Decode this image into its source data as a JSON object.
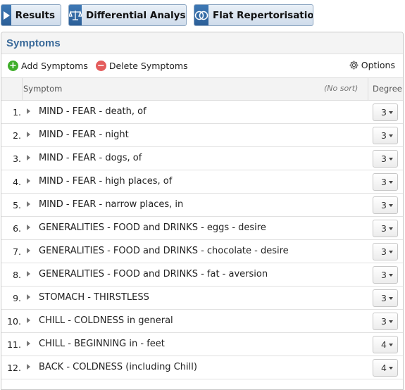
{
  "toolbar": {
    "results_label": "Results",
    "differential_label": "Differential Analysis",
    "flat_label": "Flat Repertorisation"
  },
  "panel": {
    "title": "Symptoms",
    "add_label": "Add Symptoms",
    "delete_label": "Delete Symptoms",
    "options_label": "Options"
  },
  "table": {
    "col_symptom": "Symptom",
    "sort_label": "(No sort)",
    "col_degree": "Degree",
    "rows": [
      {
        "num": "1.",
        "symptom": "MIND - FEAR - death, of",
        "degree": "3"
      },
      {
        "num": "2.",
        "symptom": "MIND - FEAR - night",
        "degree": "3"
      },
      {
        "num": "3.",
        "symptom": "MIND - FEAR - dogs, of",
        "degree": "3"
      },
      {
        "num": "4.",
        "symptom": "MIND - FEAR - high places, of",
        "degree": "3"
      },
      {
        "num": "5.",
        "symptom": "MIND - FEAR - narrow places, in",
        "degree": "3"
      },
      {
        "num": "6.",
        "symptom": "GENERALITIES - FOOD and DRINKS - eggs - desire",
        "degree": "3"
      },
      {
        "num": "7.",
        "symptom": "GENERALITIES - FOOD and DRINKS - chocolate - desire",
        "degree": "3"
      },
      {
        "num": "8.",
        "symptom": "GENERALITIES - FOOD and DRINKS - fat - aversion",
        "degree": "3"
      },
      {
        "num": "9.",
        "symptom": "STOMACH - THIRSTLESS",
        "degree": "3"
      },
      {
        "num": "10.",
        "symptom": "CHILL - COLDNESS in general",
        "degree": "3"
      },
      {
        "num": "11.",
        "symptom": "CHILL - BEGINNING in - feet",
        "degree": "4"
      },
      {
        "num": "12.",
        "symptom": "BACK - COLDNESS (including Chill)",
        "degree": "4"
      }
    ]
  },
  "colors": {
    "accent": "#3b6a9a",
    "button_icon": "#3d78b5",
    "add": "#3fae2a",
    "delete": "#e45c5c"
  },
  "icons": {
    "results": "play-icon",
    "differential": "scales-icon",
    "flat": "overlap-circles-icon",
    "options": "gear-icon"
  }
}
